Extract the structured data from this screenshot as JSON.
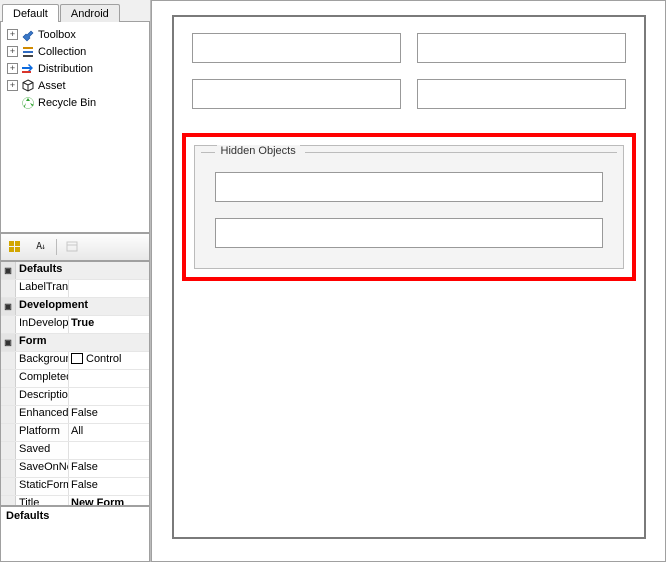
{
  "tabs": {
    "default": "Default",
    "android": "Android"
  },
  "tree": {
    "items": [
      {
        "label": "Toolbox",
        "icon": "toolbox"
      },
      {
        "label": "Collection",
        "icon": "stack"
      },
      {
        "label": "Distribution",
        "icon": "arrows"
      },
      {
        "label": "Asset",
        "icon": "cube"
      },
      {
        "label": "Recycle Bin",
        "icon": "recycle",
        "leaf": true
      }
    ]
  },
  "toolbar": {
    "cat_tip": "Categorized",
    "alpha_tip": "Alphabetical",
    "page_tip": "Property Pages"
  },
  "props": {
    "categories": [
      {
        "name": "Defaults",
        "rows": [
          {
            "name": "LabelTranslate",
            "value": ""
          }
        ]
      },
      {
        "name": "Development",
        "rows": [
          {
            "name": "InDevelopment",
            "value": "True",
            "bold": true
          }
        ]
      },
      {
        "name": "Form",
        "rows": [
          {
            "name": "BackgroundColor",
            "value": "Control",
            "swatch": true
          },
          {
            "name": "CompletedFormVersion",
            "value": ""
          },
          {
            "name": "Description",
            "value": ""
          },
          {
            "name": "EnhancedPrinting",
            "value": "False"
          },
          {
            "name": "Platform",
            "value": "All"
          },
          {
            "name": "Saved",
            "value": ""
          },
          {
            "name": "SaveOnNext",
            "value": "False"
          },
          {
            "name": "StaticForm",
            "value": "False"
          },
          {
            "name": "Title",
            "value": "New Form",
            "bold": true
          }
        ]
      }
    ],
    "desc_title": "Defaults",
    "desc_body": ""
  },
  "designer": {
    "hidden_legend": "Hidden Objects"
  }
}
